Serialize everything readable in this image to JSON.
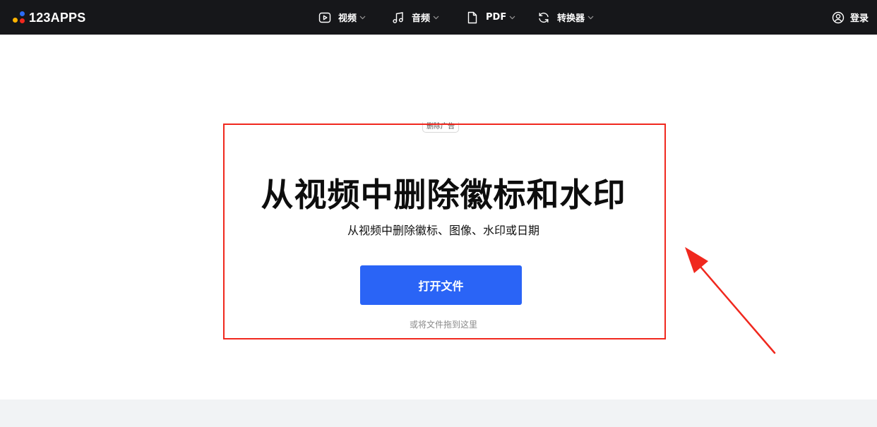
{
  "header": {
    "logo_text": "123APPS",
    "logo_dot_colors": [
      "#2b6cf6",
      "#ffb400",
      "#f0281e"
    ],
    "nav": [
      {
        "label": "视频",
        "icon": "video-icon"
      },
      {
        "label": "音频",
        "icon": "music-note-icon"
      },
      {
        "label": "PDF",
        "icon": "document-icon"
      },
      {
        "label": "转换器",
        "icon": "convert-arrows-icon"
      }
    ],
    "login_label": "登录"
  },
  "ad_label": "删除广告",
  "hero": {
    "title": "从视频中删除徽标和水印",
    "subtitle": "从视频中删除徽标、图像、水印或日期",
    "open_button": "打开文件",
    "drop_hint": "或将文件拖到这里"
  },
  "colors": {
    "header_bg": "#16171a",
    "primary_button": "#2a64f6",
    "annotation_red": "#f0281e",
    "footer_bg": "#f1f3f5"
  }
}
